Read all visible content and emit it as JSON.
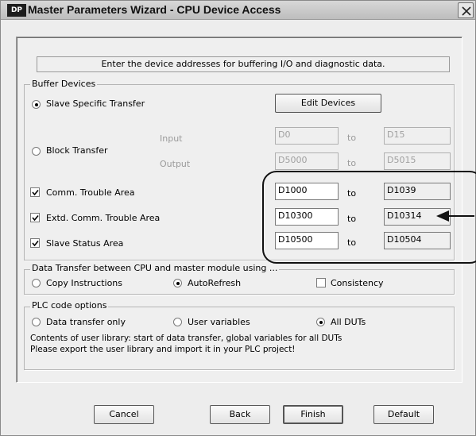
{
  "window": {
    "icon_text": "DP",
    "title": "Master Parameters Wizard - CPU Device Access"
  },
  "instruction": "Enter the device addresses for buffering I/O and diagnostic data.",
  "buffer_devices": {
    "group_label": "Buffer Devices",
    "slave_specific_transfer": "Slave Specific Transfer",
    "edit_devices": "Edit Devices",
    "block_transfer": "Block Transfer",
    "input_label": "Input",
    "output_label": "Output",
    "to": "to",
    "input_from": "D0",
    "input_to": "D15",
    "output_from": "D5000",
    "output_to": "D5015",
    "comm_trouble": {
      "label": "Comm. Trouble Area",
      "from": "D1000",
      "to": "D1039",
      "checked": true
    },
    "extd_comm_trouble": {
      "label": "Extd. Comm. Trouble Area",
      "from": "D10300",
      "to": "D10314",
      "checked": true
    },
    "slave_status": {
      "label": "Slave Status Area",
      "from": "D10500",
      "to": "D10504",
      "checked": true
    }
  },
  "data_transfer": {
    "group_label": "Data Transfer between CPU and master module using ...",
    "copy_instructions": "Copy Instructions",
    "autorefresh": "AutoRefresh",
    "consistency": "Consistency",
    "selected": "AutoRefresh",
    "consistency_checked": false
  },
  "plc_code": {
    "group_label": "PLC code options",
    "data_transfer_only": "Data transfer only",
    "user_variables": "User variables",
    "all_duts": "All DUTs",
    "selected": "All DUTs",
    "info_line1": "Contents of user library: start of data transfer, global variables for all DUTs",
    "info_line2": "Please export the user library and import it in your PLC project!"
  },
  "buttons": {
    "cancel": "Cancel",
    "back": "Back",
    "finish": "Finish",
    "default": "Default"
  },
  "colors": {
    "dialog_bg": "#ededed",
    "annotation": "#111111"
  }
}
